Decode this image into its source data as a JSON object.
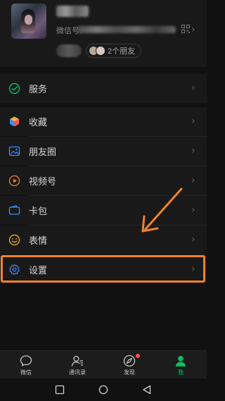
{
  "profile": {
    "wxid_prefix": "微信号：",
    "friends_label": "2个朋友"
  },
  "menu": {
    "services": "服务",
    "favorites": "收藏",
    "moments": "朋友圈",
    "channels": "视频号",
    "cards": "卡包",
    "stickers": "表情",
    "settings": "设置"
  },
  "tabs": {
    "chats": "微信",
    "contacts": "通讯录",
    "discover": "发现",
    "me": "我"
  },
  "colors": {
    "accent_green": "#07c160",
    "highlight_orange": "#f0822d",
    "badge_red": "#fa5151"
  }
}
